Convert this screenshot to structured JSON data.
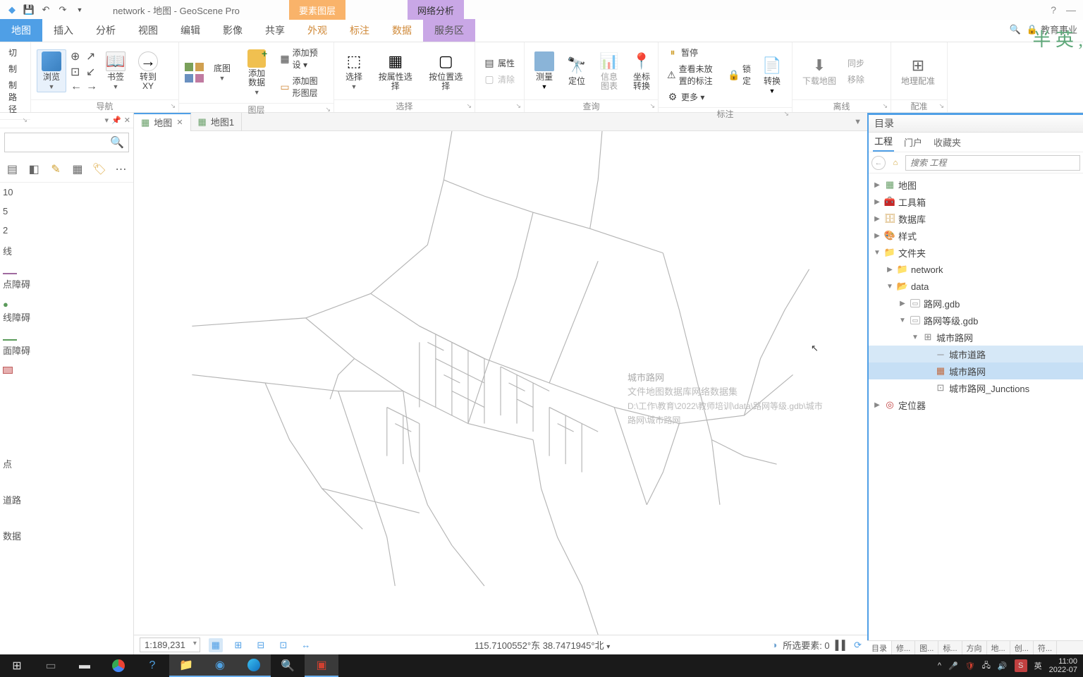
{
  "title": "network - 地图 - GeoScene Pro",
  "context_tabs": {
    "features": "要素图层",
    "network": "网络分析"
  },
  "watermark": "半 英 ,",
  "main_tabs": [
    "地图",
    "插入",
    "分析",
    "视图",
    "编辑",
    "影像",
    "共享",
    "外观",
    "标注",
    "数据",
    "服务区"
  ],
  "topbar_right": {
    "user": "教育事业",
    "search_icon": "🔍",
    "lock_icon": "🔒"
  },
  "ribbon": {
    "g0": [
      "切",
      "制",
      "制路径"
    ],
    "nav": {
      "label": "导航",
      "explore": "浏览",
      "bookmarks": "书签",
      "gotoxy": "转到\nXY"
    },
    "layer": {
      "label": "图层",
      "basemap": "底图",
      "adddata": "添加数据",
      "addpreset": "添加预设 ▾",
      "addgraphic": "添加图形图层"
    },
    "select": {
      "label": "选择",
      "select": "选择",
      "byattr": "按属性选择",
      "byloc": "按位置选择"
    },
    "attr": {
      "label": "",
      "attr": "属性",
      "clear": "清除"
    },
    "query": {
      "label": "查询",
      "measure": "测量",
      "locate": "定位",
      "info": "信息图表",
      "coord": "坐标转换"
    },
    "annotate": {
      "label": "标注",
      "pause": "暂停",
      "lock": "锁定",
      "viewunplaced": "查看未放置的标注",
      "more": "更多 ▾",
      "convert": "转换"
    },
    "offline": {
      "label": "离线",
      "download": "下载地图",
      "sync": "同步",
      "remove": "移除"
    },
    "georef": {
      "label": "配准",
      "georef": "地理配准"
    }
  },
  "left_panel": {
    "items": [
      "10",
      "5",
      "2",
      "线",
      "",
      "点障碍",
      "",
      "线障碍",
      "",
      "面障碍",
      "",
      "",
      "",
      "点",
      "",
      "道路",
      "",
      "数据"
    ]
  },
  "doctabs": [
    {
      "label": "地图",
      "active": true
    },
    {
      "label": "地图1",
      "active": false
    }
  ],
  "map_hint": {
    "title": "城市路网",
    "l1": "文件地图数据库网络数据集",
    "l2": "D:\\工作\\教育\\2022\\教师培训\\data\\路网等级.gdb\\城市路网\\城市路网"
  },
  "status": {
    "scale": "1:189,231",
    "coords": "115.7100552°东 38.7471945°北",
    "selcount": "所选要素: 0"
  },
  "catalog": {
    "title": "目录",
    "tabs": [
      "工程",
      "门户",
      "收藏夹"
    ],
    "search_placeholder": "搜索 工程",
    "tree": {
      "maps": "地图",
      "toolboxes": "工具箱",
      "databases": "数据库",
      "styles": "样式",
      "folders": "文件夹",
      "network": "network",
      "data": "data",
      "gdb1": "路网.gdb",
      "gdb2": "路网等级.gdb",
      "fd": "城市路网",
      "fc1": "城市道路",
      "nd": "城市路网",
      "junc": "城市路网_Junctions",
      "locators": "定位器"
    }
  },
  "bottom_tabs": [
    "目录",
    "修...",
    "图...",
    "标...",
    "方向",
    "地...",
    "创...",
    "符..."
  ],
  "taskbar": {
    "time": "11:00",
    "date": "2022-07",
    "ime": "英"
  }
}
